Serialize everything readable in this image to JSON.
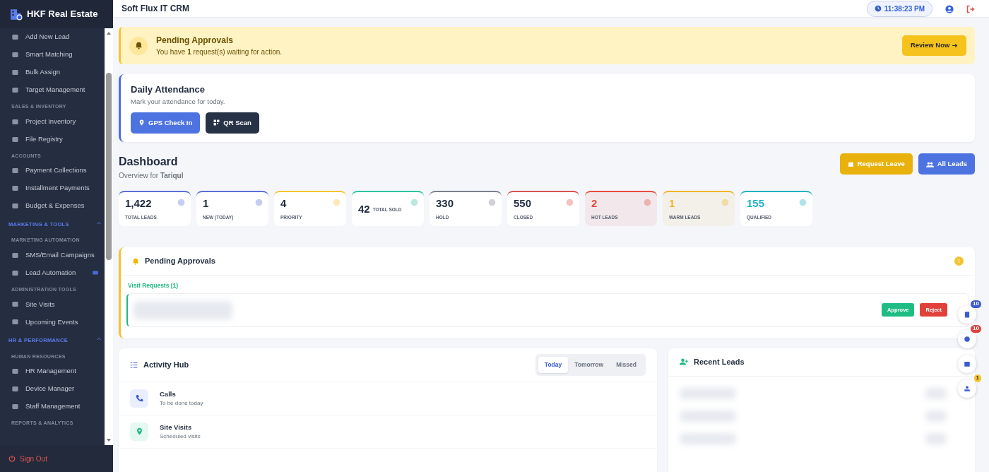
{
  "brand": {
    "name": "HKF Real Estate"
  },
  "sidebar": {
    "items": [
      {
        "kind": "item",
        "label": "Add New Lead"
      },
      {
        "kind": "item",
        "label": "Smart Matching"
      },
      {
        "kind": "item",
        "label": "Bulk Assign"
      },
      {
        "kind": "item",
        "label": "Target Management"
      },
      {
        "kind": "section",
        "label": "SALES & INVENTORY"
      },
      {
        "kind": "item",
        "label": "Project Inventory"
      },
      {
        "kind": "item",
        "label": "File Registry"
      },
      {
        "kind": "section",
        "label": "ACCOUNTS"
      },
      {
        "kind": "item",
        "label": "Payment Collections"
      },
      {
        "kind": "item",
        "label": "Installment Payments"
      },
      {
        "kind": "item",
        "label": "Budget & Expenses"
      },
      {
        "kind": "group",
        "label": "MARKETING & TOOLS",
        "expanded": true
      },
      {
        "kind": "section",
        "label": "MARKETING AUTOMATION"
      },
      {
        "kind": "item",
        "label": "SMS/Email Campaigns"
      },
      {
        "kind": "tagged",
        "label": "Lead Automation"
      },
      {
        "kind": "section",
        "label": "ADMINISTRATION TOOLS"
      },
      {
        "kind": "item",
        "label": "Site Visits"
      },
      {
        "kind": "item",
        "label": "Upcoming Events"
      },
      {
        "kind": "group",
        "label": "HR & PERFORMANCE",
        "expanded": true
      },
      {
        "kind": "section",
        "label": "HUMAN RESOURCES"
      },
      {
        "kind": "item",
        "label": "HR Management"
      },
      {
        "kind": "item",
        "label": "Device Manager"
      },
      {
        "kind": "item",
        "label": "Staff Management"
      },
      {
        "kind": "section",
        "label": "REPORTS & ANALYTICS"
      }
    ],
    "sign_out": "Sign Out"
  },
  "topbar": {
    "title": "Soft Flux IT CRM",
    "clock": "11:38:23 PM"
  },
  "alert": {
    "title": "Pending Approvals",
    "message": "You have **1** request(s) waiting for action.",
    "button": "Review Now"
  },
  "attendance": {
    "title": "Daily Attendance",
    "subtitle": "Mark your attendance for today.",
    "buttons": [
      "GPS Check In",
      "QR Scan"
    ]
  },
  "dashboard": {
    "title": "Dashboard",
    "subtitle": "Overview for **Tariqul**",
    "buttons": [
      "Request Leave",
      "All Leads"
    ]
  },
  "stats": [
    {
      "kind": "stacked",
      "value": "1,422",
      "label": "TOTAL LEADS",
      "color": "#5b6fd8",
      "tinted": false,
      "accent": false
    },
    {
      "kind": "stacked",
      "value": "1",
      "label": "NEW (TODAY)",
      "color": "#5b6fd8",
      "tinted": false,
      "accent": false
    },
    {
      "kind": "stacked",
      "value": "4",
      "label": "PRIORITY",
      "color": "#f4c430",
      "tinted": false,
      "accent": false
    },
    {
      "kind": "inline",
      "value": "42",
      "label": "TOTAL SOLD",
      "color": "#2ec4a0",
      "tinted": false,
      "accent": false
    },
    {
      "kind": "stacked",
      "value": "330",
      "label": "HOLD",
      "color": "#7a7f8c",
      "tinted": false,
      "accent": false
    },
    {
      "kind": "stacked",
      "value": "550",
      "label": "CLOSED",
      "color": "#d9534f",
      "tinted": false,
      "accent": false
    },
    {
      "kind": "stacked",
      "value": "2",
      "label": "HOT LEADS",
      "color": "#e74c3c",
      "tinted": true,
      "accent": true
    },
    {
      "kind": "stacked",
      "value": "1",
      "label": "WARM LEADS",
      "color": "#f0b429",
      "tinted": true,
      "accent": true
    },
    {
      "kind": "stacked",
      "value": "155",
      "label": "QUALIFIED",
      "color": "#20b2c0",
      "tinted": false,
      "accent": true
    }
  ],
  "approvals": {
    "title": "Pending Approvals",
    "count": "!",
    "section": "Visit Requests (1)",
    "actions": [
      "Approve",
      "Reject"
    ]
  },
  "activity": {
    "title": "Activity Hub",
    "tabs": [
      {
        "label": "Today",
        "selected": true
      },
      {
        "label": "Tomorrow",
        "selected": false
      },
      {
        "label": "Missed",
        "selected": false
      }
    ],
    "items": [
      {
        "title": "Calls",
        "subtitle": "To be done today"
      },
      {
        "title": "Site Visits",
        "subtitle": "Scheduled visits"
      }
    ]
  },
  "recent": {
    "title": "Recent Leads"
  },
  "floating": [
    {
      "kind": "badged",
      "badge": "10"
    },
    {
      "kind": "badged",
      "badge": "10"
    },
    {
      "kind": "plain"
    },
    {
      "kind": "badged",
      "badge": "1"
    }
  ]
}
